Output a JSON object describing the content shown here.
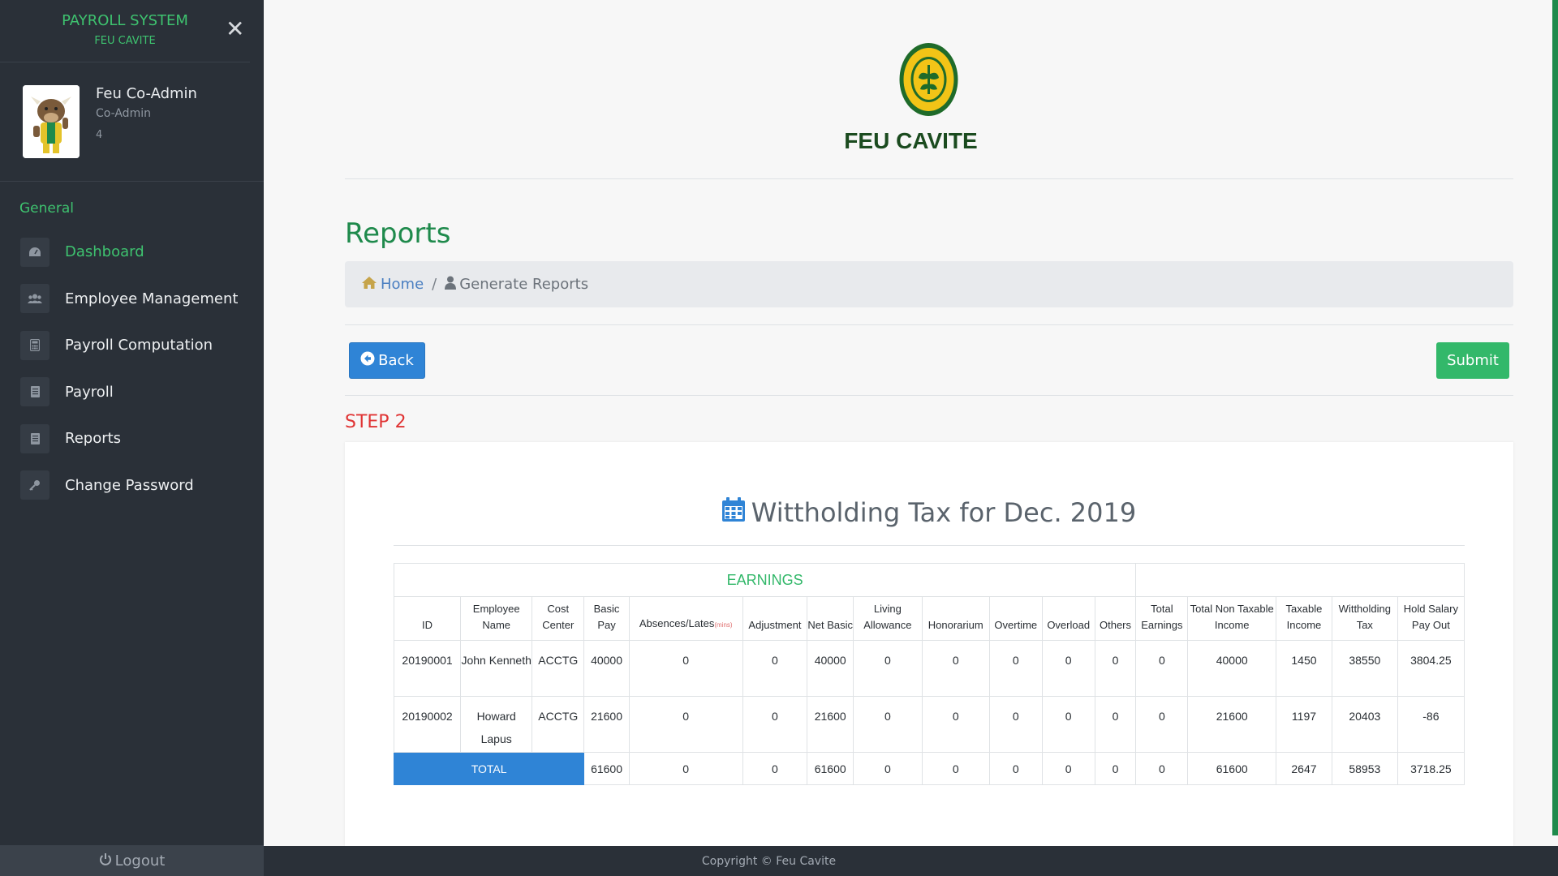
{
  "sidebar": {
    "title": "PAYROLL SYSTEM",
    "subtitle": "FEU CAVITE",
    "user": {
      "name": "Feu Co-Admin",
      "role": "Co-Admin",
      "id": "4"
    },
    "section": "General",
    "items": [
      {
        "label": "Dashboard",
        "icon": "dashboard-icon",
        "active": true
      },
      {
        "label": "Employee Management",
        "icon": "users-icon",
        "active": false
      },
      {
        "label": "Payroll Computation",
        "icon": "calculator-icon",
        "active": false
      },
      {
        "label": "Payroll",
        "icon": "document-icon",
        "active": false
      },
      {
        "label": "Reports",
        "icon": "document-icon",
        "active": false
      },
      {
        "label": "Change Password",
        "icon": "key-icon",
        "active": false
      }
    ],
    "logout": "Logout"
  },
  "header": {
    "logo_text": "FEU CAVITE"
  },
  "page": {
    "title": "Reports",
    "breadcrumb": {
      "home": "Home",
      "current": "Generate Reports"
    },
    "back_label": "Back",
    "submit_label": "Submit",
    "step": "STEP 2"
  },
  "report": {
    "title": "Wittholding Tax for Dec. 2019",
    "group_header": "EARNINGS",
    "columns": [
      "ID",
      "Employee Name",
      "Cost Center",
      "Basic Pay",
      "Absences/Lates",
      "Adjustment",
      "Net Basic",
      "Living Allowance",
      "Honorarium",
      "Overtime",
      "Overload",
      "Others",
      "Total Earnings",
      "Total Non Taxable Income",
      "Taxable Income",
      "Wittholding Tax",
      "Hold Salary Pay Out"
    ],
    "mins_note": "(mins)",
    "rows": [
      [
        "20190001",
        "John Kenneth",
        "ACCTG",
        "40000",
        "0",
        "0",
        "40000",
        "0",
        "0",
        "0",
        "0",
        "0",
        "0",
        "40000",
        "1450",
        "38550",
        "3804.25"
      ],
      [
        "20190002",
        "Howard Lapus",
        "ACCTG",
        "21600",
        "0",
        "0",
        "21600",
        "0",
        "0",
        "0",
        "0",
        "0",
        "0",
        "21600",
        "1197",
        "20403",
        "-86"
      ]
    ],
    "total_label": "TOTAL",
    "totals": [
      "61600",
      "0",
      "0",
      "61600",
      "0",
      "0",
      "0",
      "0",
      "0",
      "0",
      "61600",
      "2647",
      "58953",
      "3718.25"
    ]
  },
  "footer": {
    "copyright": "Copyright © Feu Cavite"
  },
  "colors": {
    "accent_green": "#33b86a",
    "primary_blue": "#2f84d6",
    "sidebar_bg": "#2a3038",
    "step_red": "#e03434"
  }
}
